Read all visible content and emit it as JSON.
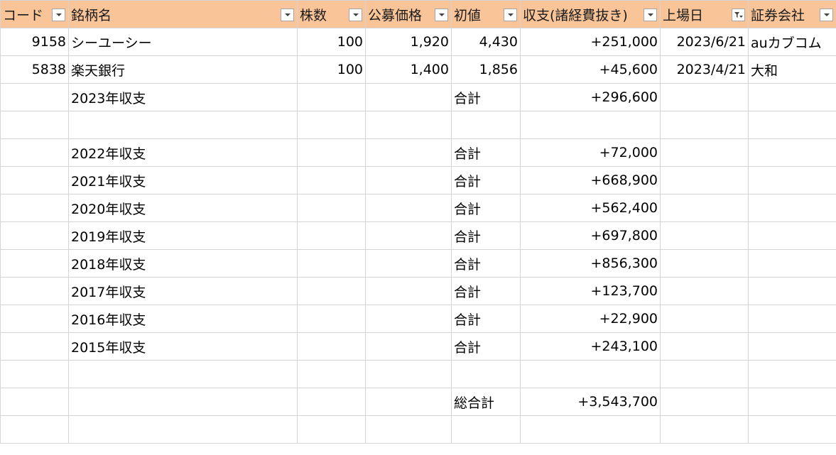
{
  "headers": [
    {
      "label": "コード",
      "filter": "dropdown"
    },
    {
      "label": "銘柄名",
      "filter": "dropdown"
    },
    {
      "label": "株数",
      "filter": "dropdown"
    },
    {
      "label": "公募価格",
      "filter": "dropdown"
    },
    {
      "label": "初値",
      "filter": "dropdown"
    },
    {
      "label": "収支(諸経費抜き)",
      "filter": "dropdown"
    },
    {
      "label": "上場日",
      "filter": "filtered"
    },
    {
      "label": "証券会社",
      "filter": "dropdown"
    }
  ],
  "rows": [
    {
      "code": "9158",
      "name": "シーユーシー",
      "shares": "100",
      "ipo_price": "1,920",
      "first_price": "4,430",
      "profit": "+251,000",
      "listing_date": "2023/6/21",
      "broker": "auカブコム"
    },
    {
      "code": "5838",
      "name": "楽天銀行",
      "shares": "100",
      "ipo_price": "1,400",
      "first_price": "1,856",
      "profit": "+45,600",
      "listing_date": "2023/4/21",
      "broker": "大和"
    },
    {
      "code": "",
      "name": "2023年収支",
      "shares": "",
      "ipo_price": "",
      "first_price": "合計",
      "profit": "+296,600",
      "listing_date": "",
      "broker": ""
    },
    {
      "code": "",
      "name": "",
      "shares": "",
      "ipo_price": "",
      "first_price": "",
      "profit": "",
      "listing_date": "",
      "broker": ""
    },
    {
      "code": "",
      "name": "2022年収支",
      "shares": "",
      "ipo_price": "",
      "first_price": "合計",
      "profit": "+72,000",
      "listing_date": "",
      "broker": ""
    },
    {
      "code": "",
      "name": "2021年収支",
      "shares": "",
      "ipo_price": "",
      "first_price": "合計",
      "profit": "+668,900",
      "listing_date": "",
      "broker": ""
    },
    {
      "code": "",
      "name": "2020年収支",
      "shares": "",
      "ipo_price": "",
      "first_price": "合計",
      "profit": "+562,400",
      "listing_date": "",
      "broker": ""
    },
    {
      "code": "",
      "name": "2019年収支",
      "shares": "",
      "ipo_price": "",
      "first_price": "合計",
      "profit": "+697,800",
      "listing_date": "",
      "broker": ""
    },
    {
      "code": "",
      "name": "2018年収支",
      "shares": "",
      "ipo_price": "",
      "first_price": "合計",
      "profit": "+856,300",
      "listing_date": "",
      "broker": ""
    },
    {
      "code": "",
      "name": "2017年収支",
      "shares": "",
      "ipo_price": "",
      "first_price": "合計",
      "profit": "+123,700",
      "listing_date": "",
      "broker": ""
    },
    {
      "code": "",
      "name": "2016年収支",
      "shares": "",
      "ipo_price": "",
      "first_price": "合計",
      "profit": "+22,900",
      "listing_date": "",
      "broker": ""
    },
    {
      "code": "",
      "name": "2015年収支",
      "shares": "",
      "ipo_price": "",
      "first_price": "合計",
      "profit": "+243,100",
      "listing_date": "",
      "broker": ""
    },
    {
      "code": "",
      "name": "",
      "shares": "",
      "ipo_price": "",
      "first_price": "",
      "profit": "",
      "listing_date": "",
      "broker": ""
    },
    {
      "code": "",
      "name": "",
      "shares": "",
      "ipo_price": "",
      "first_price": "総合計",
      "profit": "+3,543,700",
      "listing_date": "",
      "broker": ""
    },
    {
      "code": "",
      "name": "",
      "shares": "",
      "ipo_price": "",
      "first_price": "",
      "profit": "",
      "listing_date": "",
      "broker": ""
    }
  ],
  "colors": {
    "header_bg": "#f9c497",
    "gridline": "#d4d4d4"
  }
}
